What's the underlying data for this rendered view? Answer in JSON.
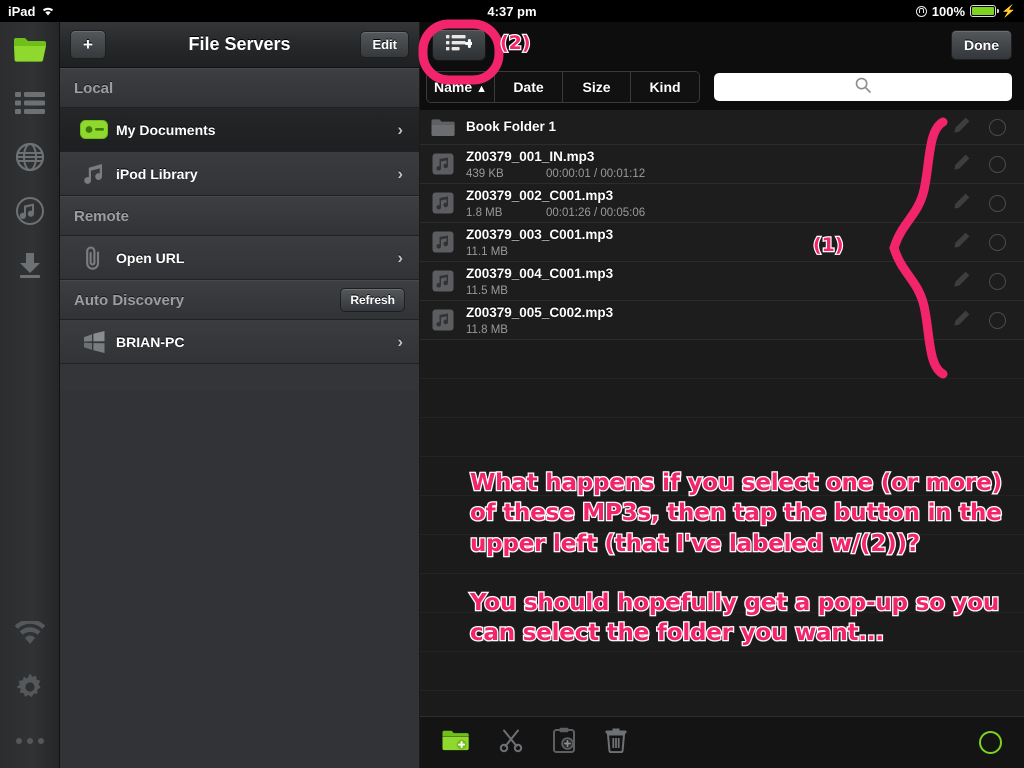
{
  "status_bar": {
    "device": "iPad",
    "wifi_icon": "wifi-icon",
    "time": "4:37 pm",
    "battery_percent": "100%",
    "rotation_lock_icon": "rotation-lock-icon",
    "charging_icon": "lightning-bolt-icon"
  },
  "colors": {
    "accent_green": "#7ed321",
    "annotation_pink": "#f2246b",
    "panel_dark": "#1b1b1b",
    "sidebar_gray": "#333538"
  },
  "rail": {
    "items": [
      {
        "name": "folder-icon",
        "label": "Files",
        "active": true
      },
      {
        "name": "list-icon",
        "label": "Playlist",
        "active": false
      },
      {
        "name": "globe-icon",
        "label": "Browser",
        "active": false
      },
      {
        "name": "music-icon",
        "label": "Music",
        "active": false
      },
      {
        "name": "download-icon",
        "label": "Downloads",
        "active": false
      }
    ],
    "bottom_items": [
      {
        "name": "wifi-icon",
        "label": "Network"
      },
      {
        "name": "gear-icon",
        "label": "Settings"
      },
      {
        "name": "more-icon",
        "label": "More"
      }
    ]
  },
  "sidebar": {
    "nav": {
      "add_label": "+",
      "title": "File Servers",
      "edit_label": "Edit"
    },
    "sections": [
      {
        "header": "Local",
        "action": null,
        "rows": [
          {
            "label": "My Documents",
            "icon": "hard-drive-icon",
            "selected": true
          },
          {
            "label": "iPod Library",
            "icon": "music-note-icon",
            "selected": false
          }
        ]
      },
      {
        "header": "Remote",
        "action": null,
        "rows": [
          {
            "label": "Open URL",
            "icon": "link-icon",
            "selected": false
          }
        ]
      },
      {
        "header": "Auto Discovery",
        "action": "Refresh",
        "rows": [
          {
            "label": "BRIAN-PC",
            "icon": "windows-icon",
            "selected": false
          }
        ]
      }
    ]
  },
  "file_panel": {
    "nav": {
      "add_to_playlist_icon": "list-add-icon",
      "done_label": "Done"
    },
    "sort": {
      "options": [
        "Name",
        "Date",
        "Size",
        "Kind"
      ],
      "active": "Name",
      "direction_arrow": "▲"
    },
    "search": {
      "value": "",
      "placeholder": "",
      "icon": "search-icon"
    },
    "rows": [
      {
        "type": "folder",
        "name": "Book Folder 1",
        "size": "",
        "time": "",
        "icon": "folder-icon"
      },
      {
        "type": "file",
        "name": "Z00379_001_IN.mp3",
        "size": "439 KB",
        "time": "00:00:01 / 00:01:12",
        "icon": "music-file-icon"
      },
      {
        "type": "file",
        "name": "Z00379_002_C001.mp3",
        "size": "1.8 MB",
        "time": "00:01:26 / 00:05:06",
        "icon": "music-file-icon"
      },
      {
        "type": "file",
        "name": "Z00379_003_C001.mp3",
        "size": "11.1 MB",
        "time": "",
        "icon": "music-file-icon"
      },
      {
        "type": "file",
        "name": "Z00379_004_C001.mp3",
        "size": "11.5 MB",
        "time": "",
        "icon": "music-file-icon"
      },
      {
        "type": "file",
        "name": "Z00379_005_C002.mp3",
        "size": "11.8 MB",
        "time": "",
        "icon": "music-file-icon"
      }
    ],
    "row_actions": {
      "rename_icon": "pencil-icon",
      "select_icon": "circle-unchecked-icon"
    },
    "toolbar": [
      {
        "name": "new-folder-icon",
        "label": "New Folder"
      },
      {
        "name": "cut-icon",
        "label": "Cut"
      },
      {
        "name": "paste-icon",
        "label": "Paste"
      },
      {
        "name": "trash-icon",
        "label": "Delete"
      }
    ],
    "toolbar_right": {
      "name": "select-all-icon",
      "label": "Select All"
    }
  },
  "annotations": {
    "label_1": "(1)",
    "label_2": "(2)",
    "paragraph_1": "What happens if you select one (or more)\nof these MP3s, then tap the button in the\nupper left (that I've labeled w/(2))?",
    "paragraph_2": "You should hopefully get a pop-up so you\ncan select the folder you want...",
    "highlight_circle": "button-highlight-circle",
    "brace": "curly-brace-bracket"
  }
}
